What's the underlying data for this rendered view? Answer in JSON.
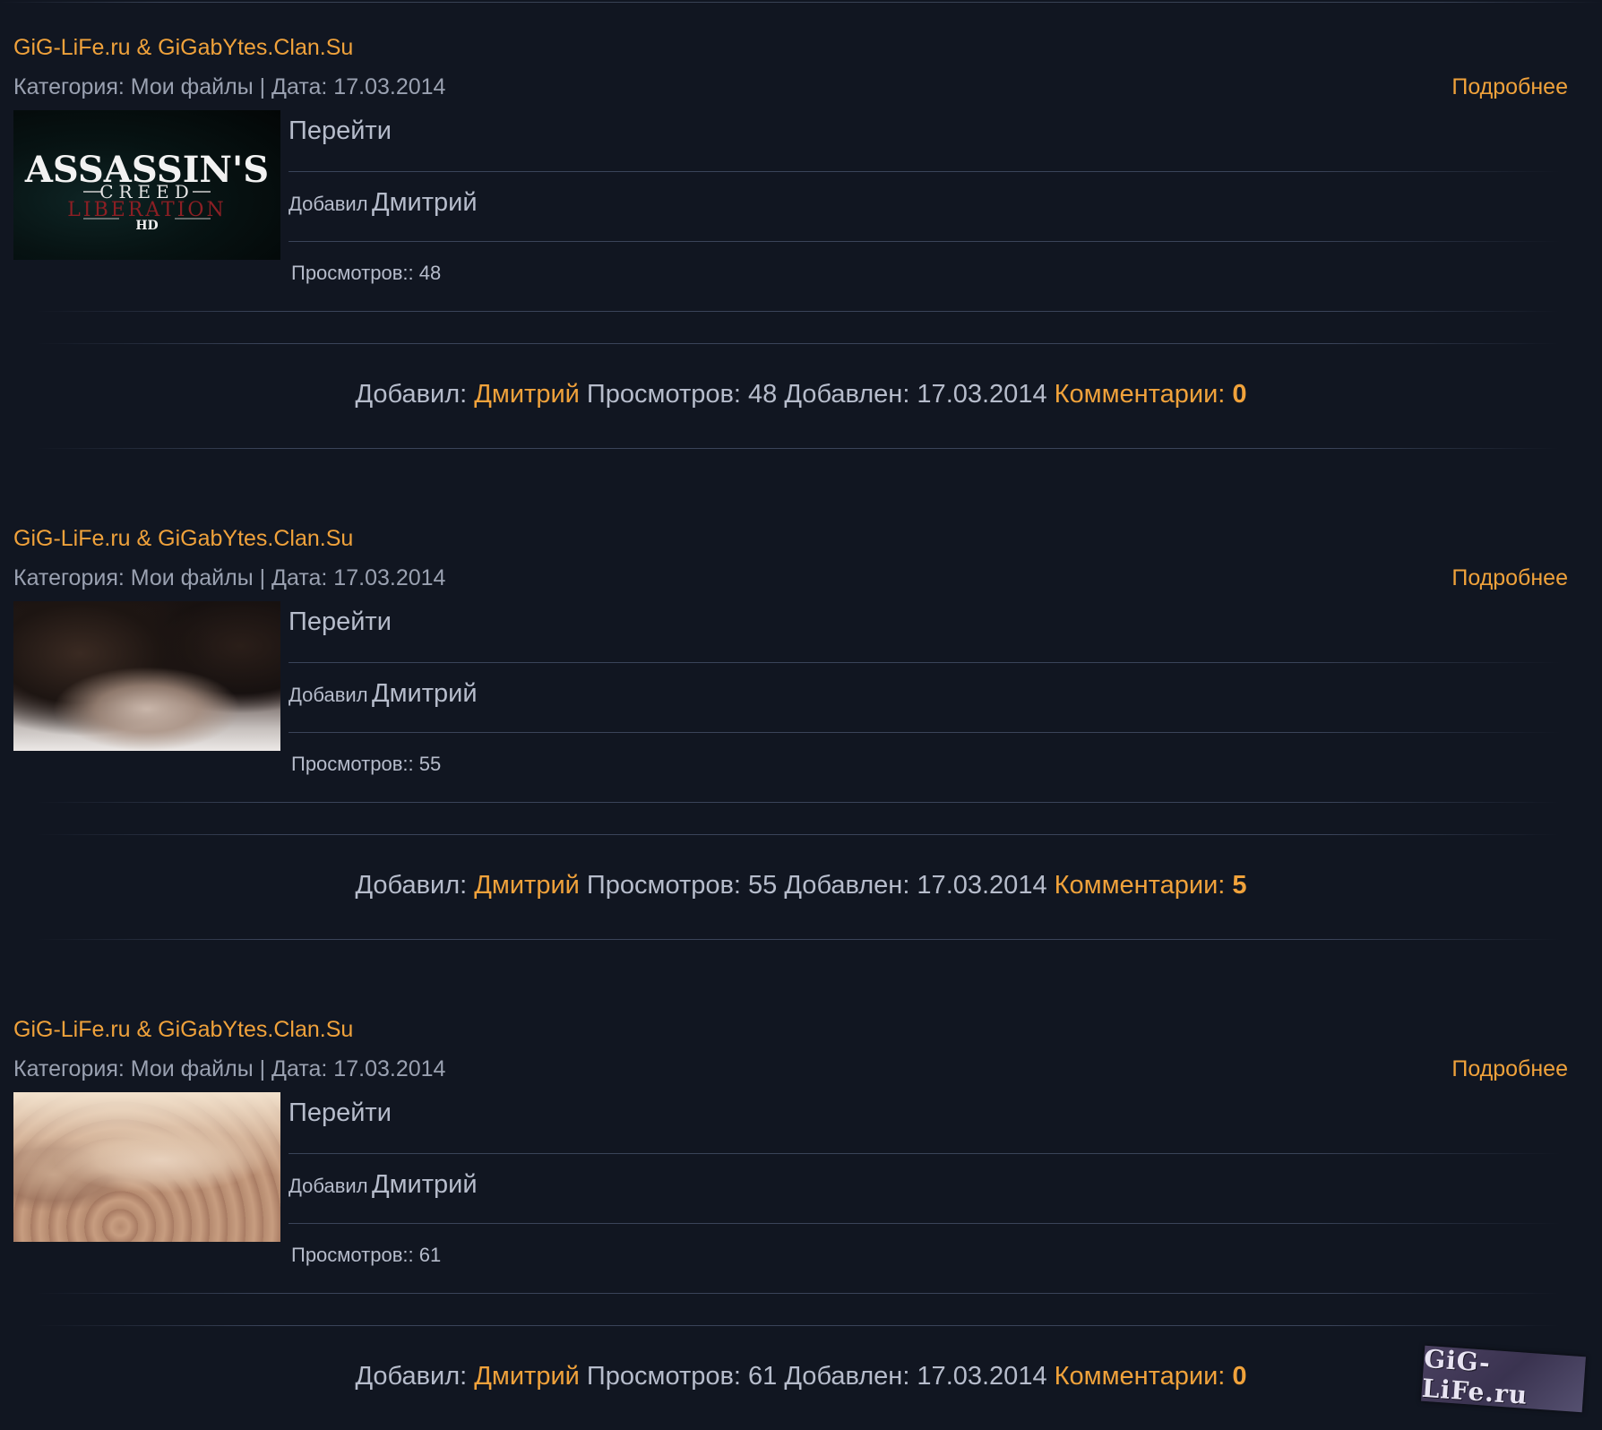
{
  "entries": [
    {
      "title": "GiG-LiFe.ru & GiGabYtes.Clan.Su",
      "meta": "Категория: Мои файлы | Дата: 17.03.2014",
      "more_label": "Подробнее",
      "goto_label": "Перейти",
      "added_label": "Добавил",
      "added_name": "Дмитрий",
      "views_text": "Просмотров:: 48",
      "thumb_alt": "Assassin's Creed Liberation HD",
      "footer": {
        "added_label": "Добавил:",
        "author": "Дмитрий",
        "views": "Просмотров: 48",
        "date": "Добавлен: 17.03.2014",
        "comments_label": "Комментарии:",
        "comments_count": "0"
      }
    },
    {
      "title": "GiG-LiFe.ru & GiGabYtes.Clan.Su",
      "meta": "Категория: Мои файлы | Дата: 17.03.2014",
      "more_label": "Подробнее",
      "goto_label": "Перейти",
      "added_label": "Добавил",
      "added_name": "Дмитрий",
      "views_text": "Просмотров:: 55",
      "footer": {
        "added_label": "Добавил:",
        "author": "Дмитрий",
        "views": "Просмотров: 55",
        "date": "Добавлен: 17.03.2014",
        "comments_label": "Комментарии:",
        "comments_count": "5"
      }
    },
    {
      "title": "GiG-LiFe.ru & GiGabYtes.Clan.Su",
      "meta": "Категория: Мои файлы | Дата: 17.03.2014",
      "more_label": "Подробнее",
      "goto_label": "Перейти",
      "added_label": "Добавил",
      "added_name": "Дмитрий",
      "views_text": "Просмотров:: 61",
      "footer": {
        "added_label": "Добавил:",
        "author": "Дмитрий",
        "views": "Просмотров: 61",
        "date": "Добавлен: 17.03.2014",
        "comments_label": "Комментарии:",
        "comments_count": "0"
      }
    }
  ],
  "thumb_logo": {
    "line1": "ASSASSIN'S",
    "line2": "CREED",
    "line3": "LIBERATION",
    "line4": "HD"
  },
  "watermark": "GiG-LiFe.ru",
  "colors": {
    "background": "#111621",
    "accent": "#f0a23b",
    "text": "#b6bccb",
    "muted": "#9aa1b1"
  }
}
